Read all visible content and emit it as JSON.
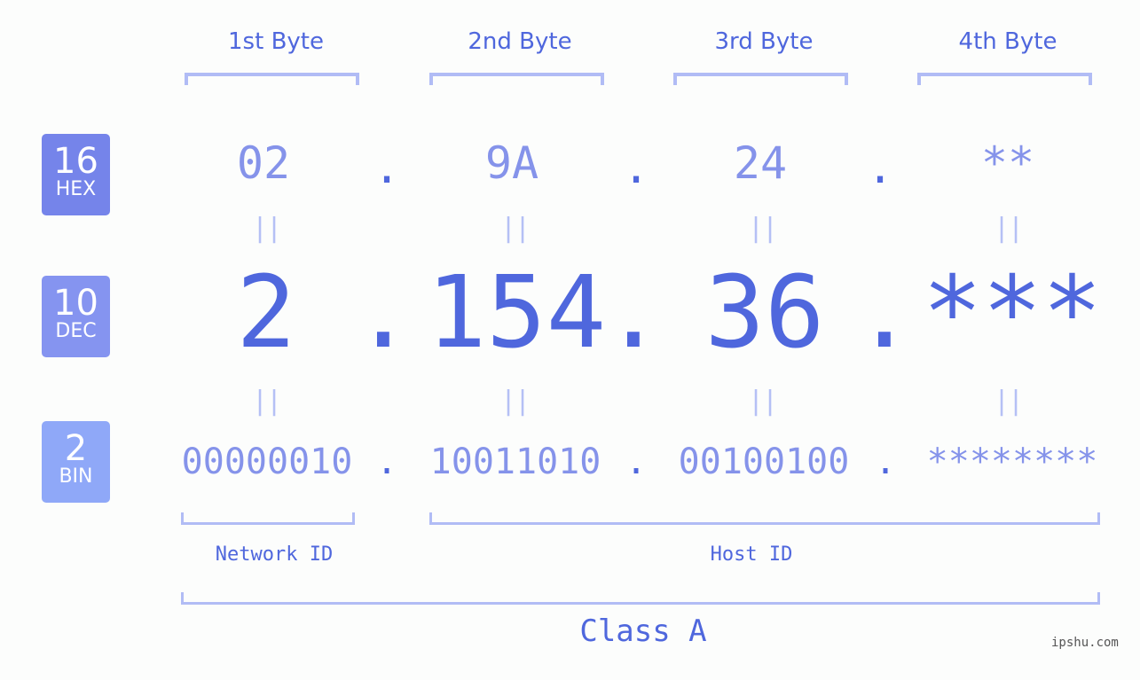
{
  "badges": [
    {
      "number": "16",
      "label": "HEX",
      "color": "#7584ea"
    },
    {
      "number": "10",
      "label": "DEC",
      "color": "#8594f0"
    },
    {
      "number": "2",
      "label": "BIN",
      "color": "#8fa8f8"
    }
  ],
  "byte_headers": [
    "1st Byte",
    "2nd Byte",
    "3rd Byte",
    "4th Byte"
  ],
  "hex": [
    "02",
    "9A",
    "24",
    "**"
  ],
  "dec": [
    "2",
    "154",
    "36",
    "***"
  ],
  "bin": [
    "00000010",
    "10011010",
    "00100100",
    "********"
  ],
  "separator": ".",
  "equals": "||",
  "network_label": "Network ID",
  "host_label": "Host ID",
  "class_label": "Class A",
  "watermark": "ipshu.com",
  "colors": {
    "primary": "#4f67dd",
    "secondary": "#8593ea",
    "bracket": "#b1bcf5"
  }
}
